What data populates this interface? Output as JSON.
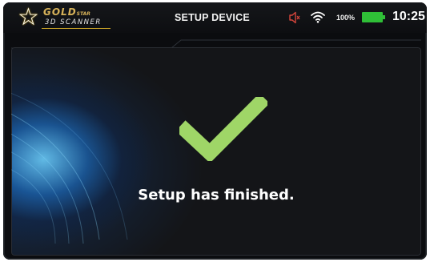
{
  "header": {
    "logo": {
      "brand": "GOLD",
      "brand_small": "STAR",
      "product": "3D SCANNER"
    },
    "title": "SETUP DEVICE",
    "battery_percent": "100%",
    "time": "10:25"
  },
  "icons": {
    "speaker": "speaker-muted-icon",
    "wifi": "wifi-icon",
    "battery": "battery-full-icon",
    "success": "checkmark-icon"
  },
  "colors": {
    "battery": "#2fbf37",
    "checkmark": "#9fd667",
    "accent_gold": "#d8b35a"
  },
  "main": {
    "message": "Setup has finished."
  }
}
